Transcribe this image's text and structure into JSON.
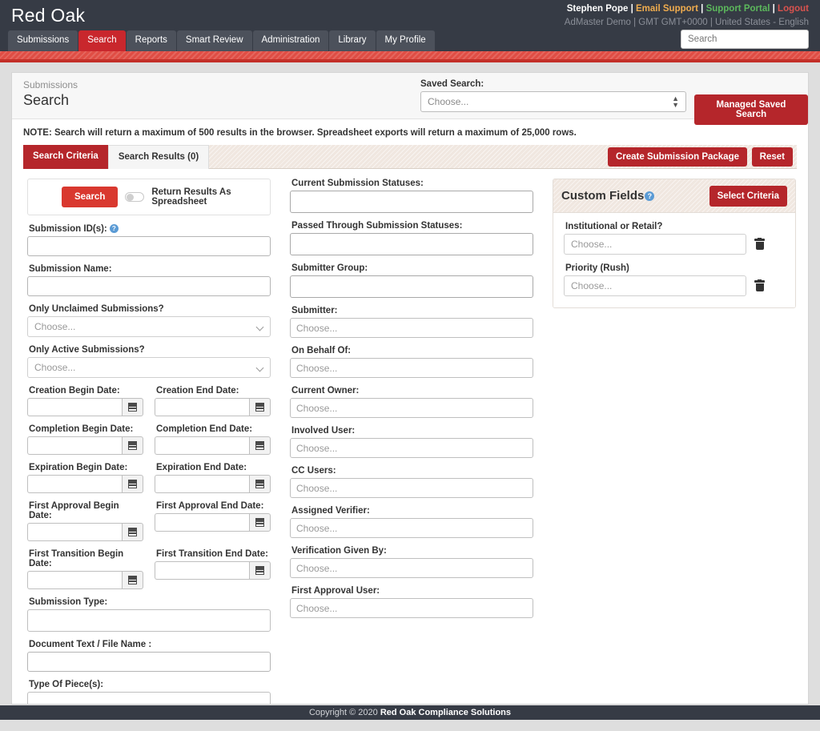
{
  "header": {
    "brand": "Red Oak",
    "user_name": "Stephen Pope",
    "email_support": "Email Support",
    "support_portal": "Support Portal",
    "logout": "Logout",
    "org_line": "AdMaster Demo | GMT GMT+0000 | United States - English",
    "search_placeholder": "Search",
    "search_value": "",
    "nav": [
      {
        "label": "Submissions",
        "active": false
      },
      {
        "label": "Search",
        "active": true
      },
      {
        "label": "Reports",
        "active": false
      },
      {
        "label": "Smart Review",
        "active": false
      },
      {
        "label": "Administration",
        "active": false
      },
      {
        "label": "Library",
        "active": false
      },
      {
        "label": "My Profile",
        "active": false
      }
    ]
  },
  "page": {
    "breadcrumb": "Submissions",
    "title": "Search",
    "saved_search_label": "Saved Search:",
    "saved_search_value": "Choose...",
    "managed_saved_search": "Managed Saved Search",
    "note": "NOTE: Search will return a maximum of 500 results in the browser. Spreadsheet exports will return a maximum of 25,000 rows.",
    "tab_criteria": "Search Criteria",
    "tab_results": "Search Results (0)",
    "create_submission_package": "Create Submission Package",
    "reset": "Reset"
  },
  "search_panel": {
    "search_button": "Search",
    "spreadsheet_toggle_label": "Return Results As Spreadsheet",
    "spreadsheet_toggle_on": false
  },
  "left_column": {
    "submission_ids_label": "Submission ID(s):",
    "submission_ids_value": "",
    "submission_name_label": "Submission Name:",
    "submission_name_value": "",
    "only_unclaimed_label": "Only Unclaimed Submissions?",
    "only_unclaimed_value": "Choose...",
    "only_active_label": "Only Active Submissions?",
    "only_active_value": "Choose...",
    "dates": [
      {
        "begin_label": "Creation Begin Date:",
        "begin_value": "",
        "end_label": "Creation End Date:",
        "end_value": ""
      },
      {
        "begin_label": "Completion Begin Date:",
        "begin_value": "",
        "end_label": "Completion End Date:",
        "end_value": ""
      },
      {
        "begin_label": "Expiration Begin Date:",
        "begin_value": "",
        "end_label": "Expiration End Date:",
        "end_value": ""
      },
      {
        "begin_label": "First Approval Begin Date:",
        "begin_value": "",
        "end_label": "First Approval End Date:",
        "end_value": ""
      },
      {
        "begin_label": "First Transition Begin Date:",
        "begin_value": "",
        "end_label": "First Transition End Date:",
        "end_value": ""
      }
    ],
    "submission_type_label": "Submission Type:",
    "submission_type_value": "",
    "document_text_label": "Document Text / File Name :",
    "document_text_value": "",
    "type_of_pieces_label": "Type Of Piece(s):",
    "type_of_pieces_value": ""
  },
  "mid_column": {
    "current_statuses_label": "Current Submission Statuses:",
    "current_statuses_value": "",
    "passed_statuses_label": "Passed Through Submission Statuses:",
    "passed_statuses_value": "",
    "submitter_group_label": "Submitter Group:",
    "submitter_group_value": "",
    "submitter_label": "Submitter:",
    "submitter_placeholder": "Choose...",
    "on_behalf_of_label": "On Behalf Of:",
    "on_behalf_of_placeholder": "Choose...",
    "current_owner_label": "Current Owner:",
    "current_owner_placeholder": "Choose...",
    "involved_user_label": "Involved User:",
    "involved_user_placeholder": "Choose...",
    "cc_users_label": "CC Users:",
    "cc_users_placeholder": "Choose...",
    "assigned_verifier_label": "Assigned Verifier:",
    "assigned_verifier_placeholder": "Choose...",
    "verification_given_by_label": "Verification Given By:",
    "verification_given_by_placeholder": "Choose...",
    "first_approval_user_label": "First Approval User:",
    "first_approval_user_placeholder": "Choose..."
  },
  "custom_fields": {
    "title": "Custom Fields",
    "select_criteria": "Select Criteria",
    "rows": [
      {
        "label": "Institutional or Retail?",
        "value": "Choose..."
      },
      {
        "label": "Priority (Rush)",
        "value": "Choose..."
      }
    ]
  },
  "footer": {
    "copyright_prefix": "Copyright © 2020 ",
    "company": "Red Oak Compliance Solutions"
  },
  "colors": {
    "brand_dark": "#363b45",
    "brand_red": "#b5262b",
    "accent_red": "#d9382f",
    "band_red": "#e04d44",
    "panel_beige": "#f0e7e0",
    "help_blue": "#5b9bd5",
    "link_yellow": "#f0ad4e",
    "link_green": "#5cb85c",
    "link_red": "#d9534f"
  }
}
